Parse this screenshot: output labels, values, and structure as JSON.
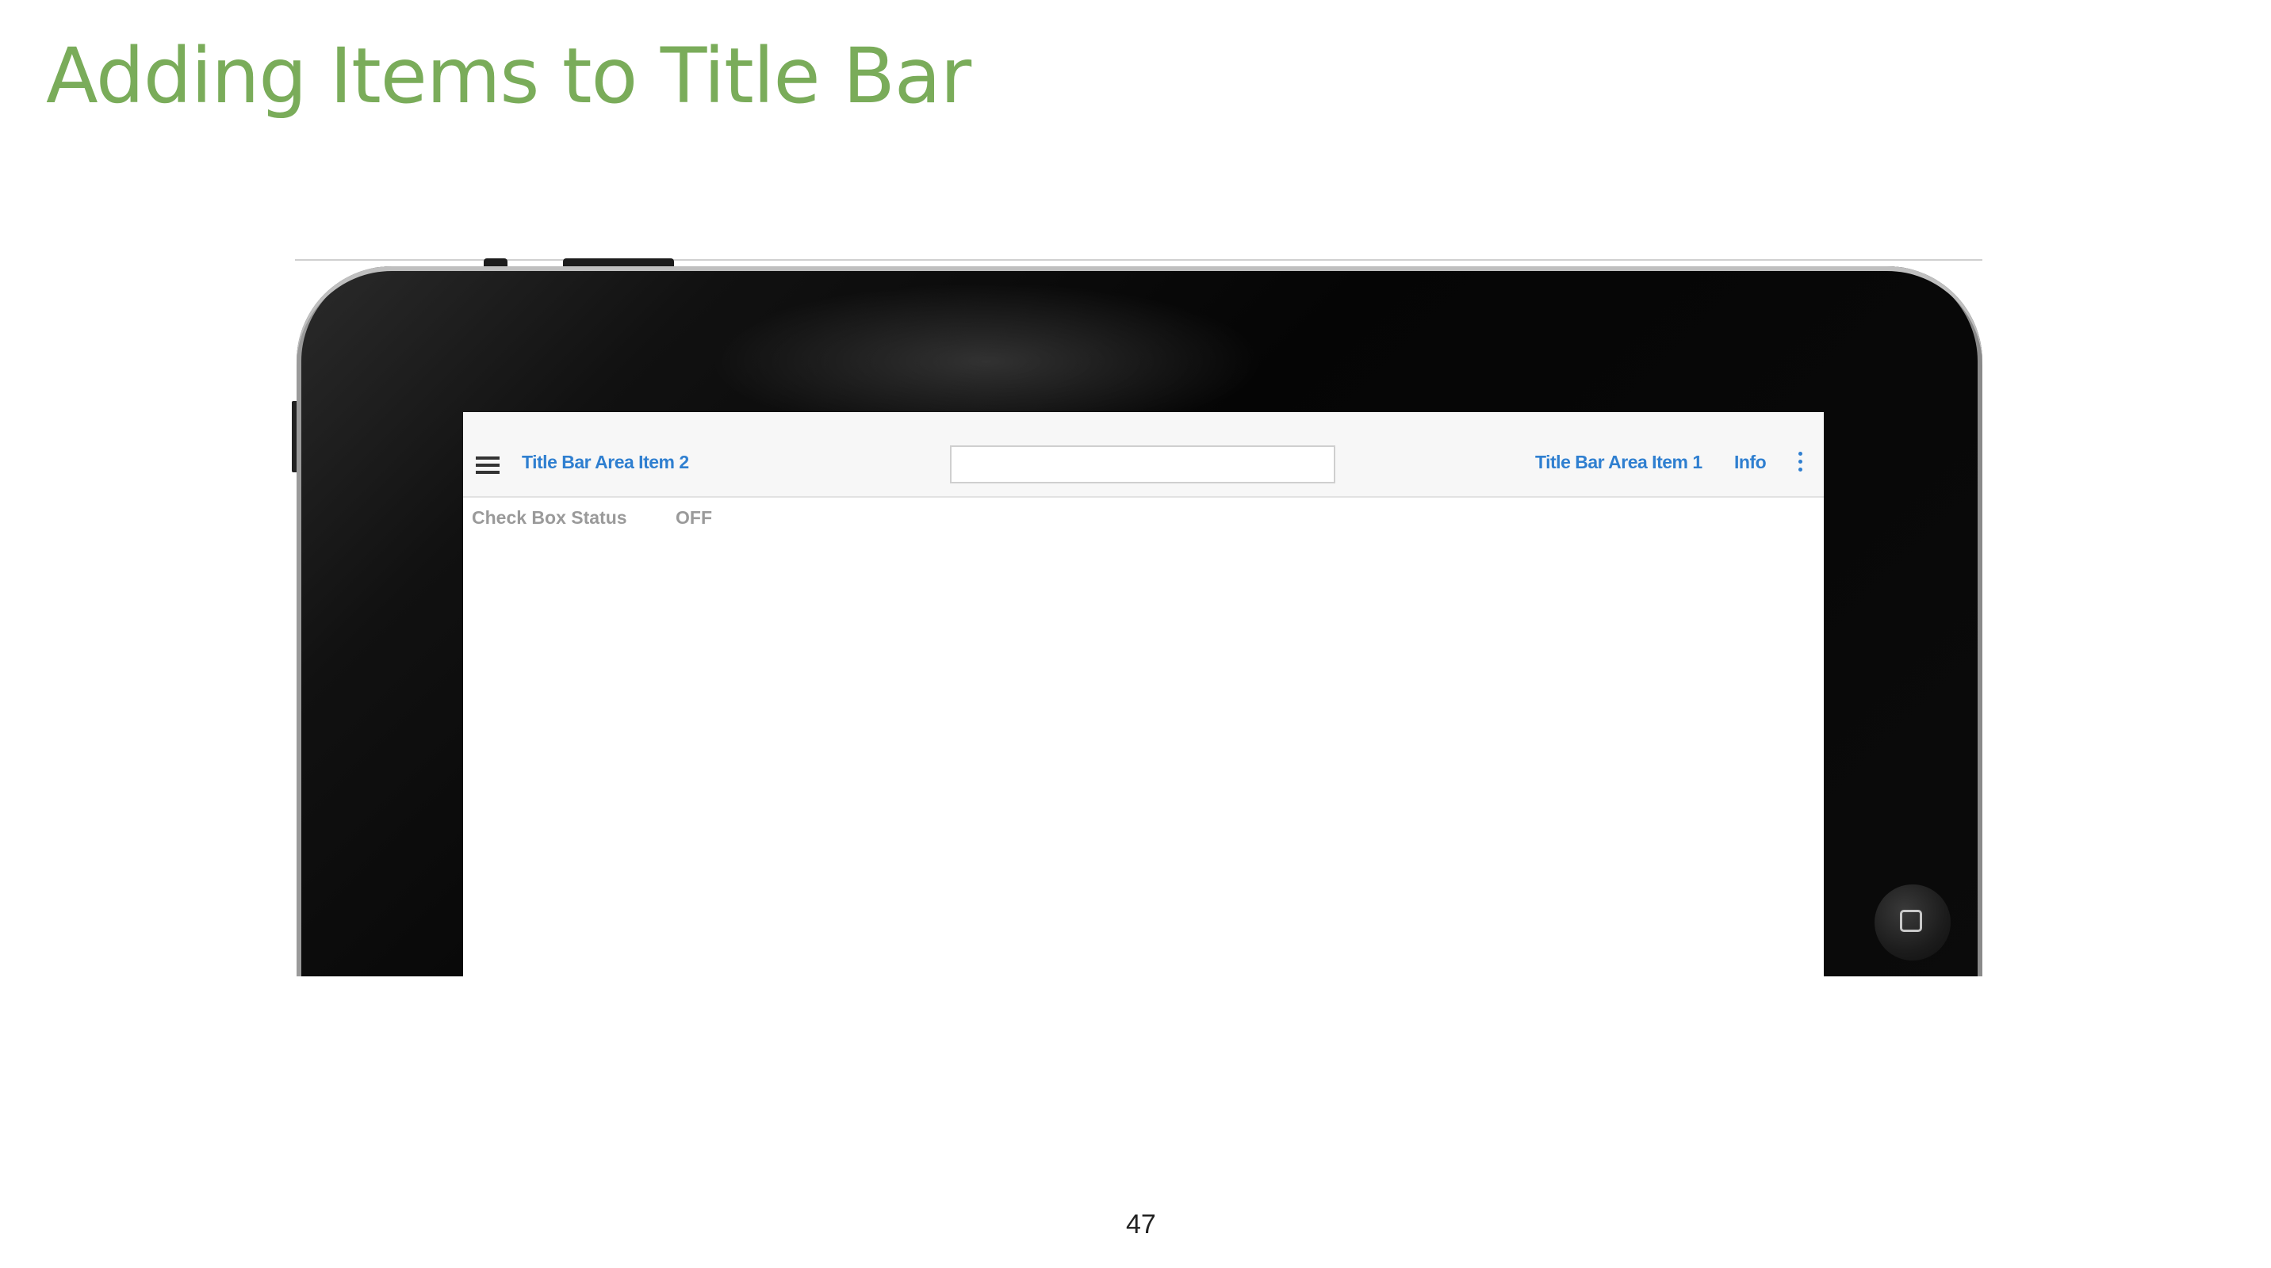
{
  "slide": {
    "title": "Adding Items to Title Bar",
    "page_number": "47"
  },
  "title_bar": {
    "menu_icon": "hamburger-icon",
    "left_item_label": "Title Bar Area Item 2",
    "search": {
      "value": "",
      "placeholder": ""
    },
    "right_item_label": "Title Bar Area Item 1",
    "info_label": "Info",
    "overflow_icon": "kebab-icon"
  },
  "content": {
    "checkbox_status_label": "Check Box Status",
    "checkbox_status_value": "OFF"
  },
  "device": {
    "home_icon": "home-square-icon"
  },
  "colors": {
    "title_green": "#7aac5a",
    "link_blue": "#2f7fd0",
    "status_gray": "#9a9a9a",
    "bezel_black": "#050505"
  }
}
